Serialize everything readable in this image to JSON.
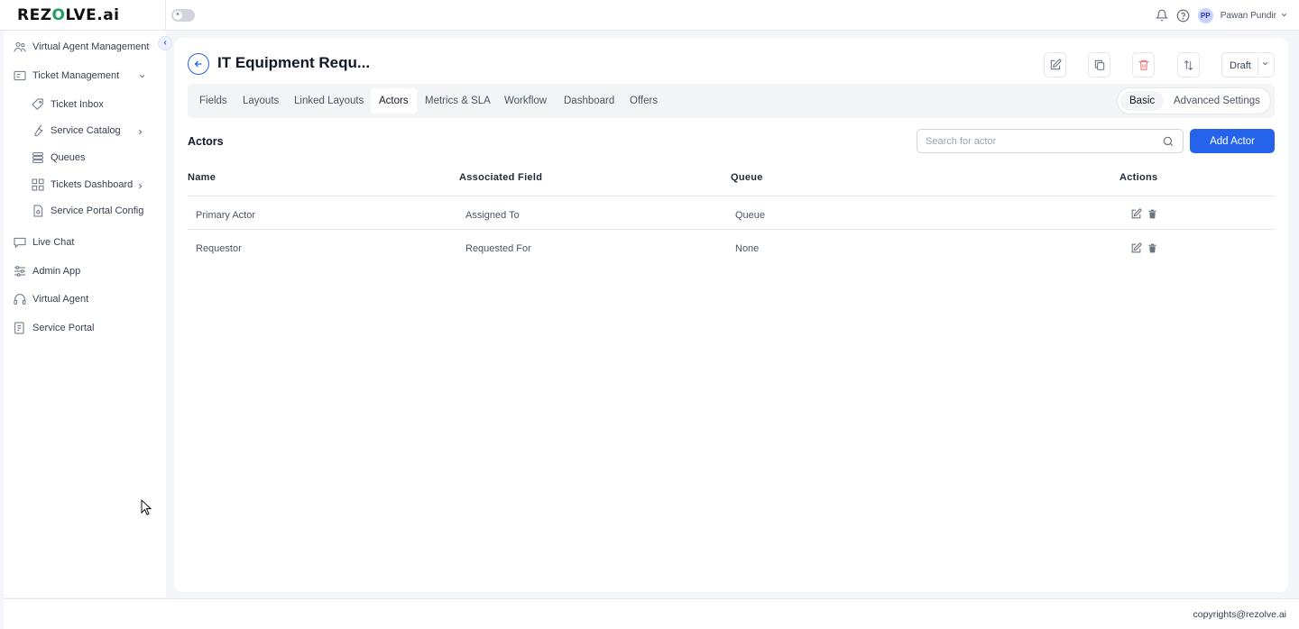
{
  "app": {
    "logo_text_a": "REZ",
    "logo_text_o": "O",
    "logo_text_b": "LVE.ai"
  },
  "topbar": {
    "user_initials": "PP",
    "user_name": "Pawan Pundir",
    "icons": [
      "bell-icon",
      "help-icon",
      "chevron-down-icon"
    ]
  },
  "sidebar": {
    "items": [
      {
        "label": "Virtual Agent Management",
        "icon": "agents-icon"
      },
      {
        "label": "Ticket Management",
        "icon": "ticket-icon"
      },
      {
        "label": "Ticket Inbox",
        "icon": "tag-icon"
      },
      {
        "label": "Service Catalog",
        "icon": "wrench-icon"
      },
      {
        "label": "Queues",
        "icon": "queue-icon"
      },
      {
        "label": "Tickets Dashboard",
        "icon": "grid-icon"
      },
      {
        "label": "Service Portal Config",
        "icon": "file-gear-icon"
      },
      {
        "label": "Live Chat",
        "icon": "chat-icon"
      },
      {
        "label": "Admin App",
        "icon": "sliders-icon"
      },
      {
        "label": "Virtual Agent",
        "icon": "headset-icon"
      },
      {
        "label": "Service Portal",
        "icon": "portal-icon"
      }
    ]
  },
  "page": {
    "title": "IT Equipment Requ...",
    "status": "Draft"
  },
  "tabs": [
    {
      "label": "Fields"
    },
    {
      "label": "Layouts"
    },
    {
      "label": "Linked Layouts"
    },
    {
      "label": "Actors",
      "active": true
    },
    {
      "label": "Metrics & SLA"
    },
    {
      "label": "Workflow"
    },
    {
      "label": "Dashboard"
    },
    {
      "label": "Offers"
    }
  ],
  "mode": {
    "basic": "Basic",
    "advanced": "Advanced Settings",
    "selected": "Basic"
  },
  "actors": {
    "title": "Actors",
    "search_placeholder": "Search for actor",
    "add_label": "Add Actor",
    "columns": [
      "Name",
      "Associated Field",
      "Queue",
      "Actions"
    ],
    "rows": [
      {
        "name": "Primary Actor",
        "field": "Assigned To",
        "queue": "Queue"
      },
      {
        "name": "Requestor",
        "field": "Requested For",
        "queue": "None"
      }
    ]
  },
  "footer": {
    "copyright": "copyrights@rezolve.ai"
  },
  "colors": {
    "accent": "#2563eb",
    "danger": "#f87171",
    "logo_green": "#22a05a"
  }
}
